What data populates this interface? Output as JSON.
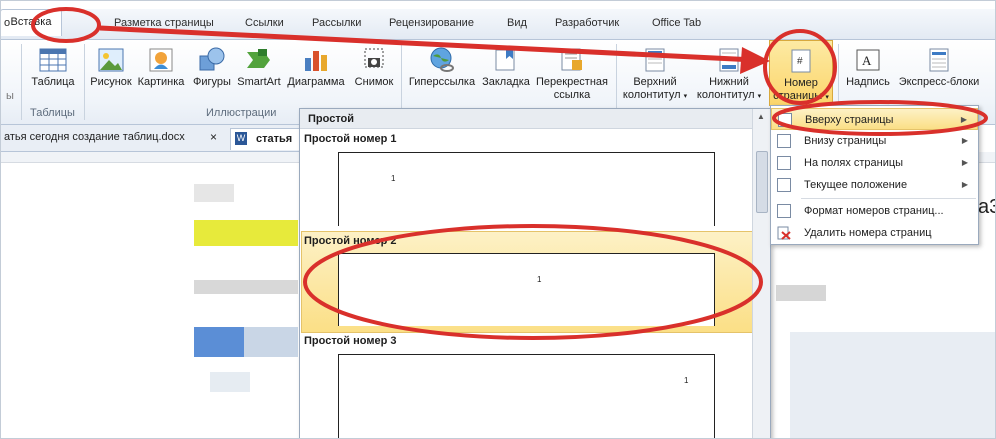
{
  "tabs": [
    {
      "label": "о",
      "active": false
    },
    {
      "label": "Вставка",
      "active": true
    },
    {
      "label": "Разметка страницы",
      "active": false
    },
    {
      "label": "Ссылки",
      "active": false
    },
    {
      "label": "Рассылки",
      "active": false
    },
    {
      "label": "Рецензирование",
      "active": false
    },
    {
      "label": "Вид",
      "active": false
    },
    {
      "label": "Разработчик",
      "active": false
    },
    {
      "label": "Office Tab",
      "active": false
    }
  ],
  "ribbon": {
    "buttons": {
      "table": "Таблица",
      "picture": "Рисунок",
      "clipart": "Картинка",
      "shapes": "Фигуры",
      "smartart": "SmartArt",
      "chart": "Диаграмма",
      "screenshot": "Снимок",
      "hyperlink": "Гиперссылка",
      "bookmark": "Закладка",
      "crossref_1": "Перекрестная",
      "crossref_2": "ссылка",
      "header_1": "Верхний",
      "header_2": "колонтитул",
      "footer_1": "Нижний",
      "footer_2": "колонтитул",
      "pagenum_1": "Номер",
      "pagenum_2": "страницы",
      "textbox": "Надпись",
      "quickparts": "Экспресс-блоки"
    },
    "groups": {
      "tables": "Таблицы",
      "illustrations": "Иллюстрации"
    }
  },
  "doc_tabs": {
    "file_name": "атья сегодня создание таблиц.docx",
    "close": "×",
    "active_file": "статья"
  },
  "gallery": {
    "header": "Простой",
    "items": [
      {
        "title": "Простой номер 1",
        "num": "1"
      },
      {
        "title": "Простой номер 2",
        "num": "1"
      },
      {
        "title": "Простой номер 3",
        "num": "1"
      }
    ]
  },
  "menu": {
    "items": [
      {
        "label": "Вверху страницы",
        "submenu": true,
        "highlighted": true
      },
      {
        "label": "Внизу страницы",
        "submenu": true,
        "highlighted": false
      },
      {
        "label": "На полях страницы",
        "submenu": true,
        "highlighted": false
      },
      {
        "label": "Текущее положение",
        "submenu": true,
        "highlighted": false
      },
      {
        "label": "Формат номеров страниц...",
        "submenu": false,
        "highlighted": false
      },
      {
        "label": "Удалить номера страниц",
        "submenu": false,
        "highlighted": false
      }
    ]
  },
  "doc_text": {
    "right_fragment": "a3"
  },
  "colors": {
    "annotation_red": "#d9302b",
    "highlight": "#fbdf86",
    "ribbon_border": "#b7c5d8"
  }
}
